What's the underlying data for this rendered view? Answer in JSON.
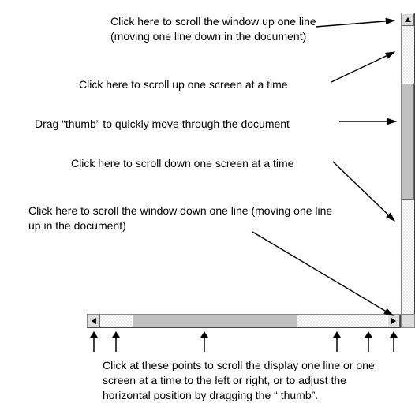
{
  "labels": {
    "up_line": "Click here to scroll the window up one line (moving one line down in the document)",
    "up_screen": "Click here to scroll up one screen at a time",
    "thumb_drag": "Drag “thumb” to quickly move through the document",
    "down_screen": "Click here to scroll down one screen at a time",
    "down_line": "Click here to scroll the window down one line (moving one line up in the document)",
    "horizontal": "Click at these points to scroll the display one line or one screen at a time to the left or right, or to adjust the horizontal position by dragging the “      thumb”."
  }
}
